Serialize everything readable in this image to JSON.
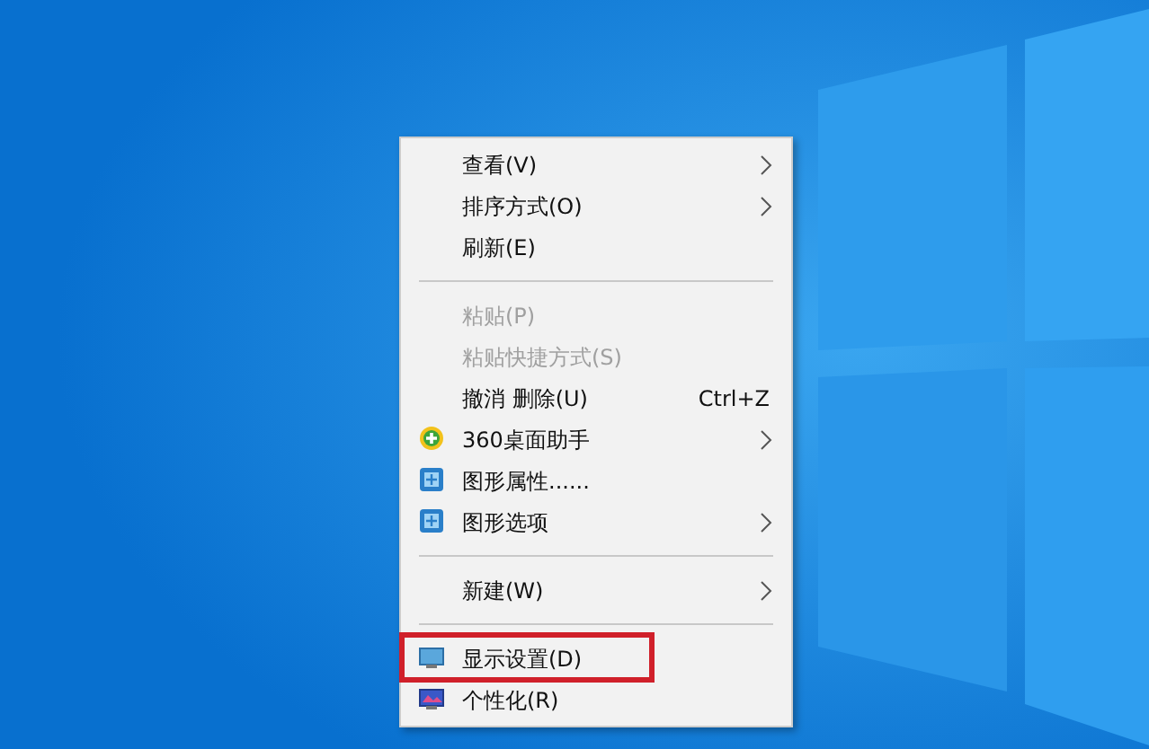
{
  "context_menu": {
    "items": [
      {
        "kind": "item",
        "label": "查看(V)",
        "submenu": true,
        "disabled": false
      },
      {
        "kind": "item",
        "label": "排序方式(O)",
        "submenu": true,
        "disabled": false
      },
      {
        "kind": "item",
        "label": "刷新(E)",
        "submenu": false,
        "disabled": false
      },
      {
        "kind": "separator"
      },
      {
        "kind": "item",
        "label": "粘贴(P)",
        "submenu": false,
        "disabled": true
      },
      {
        "kind": "item",
        "label": "粘贴快捷方式(S)",
        "submenu": false,
        "disabled": true
      },
      {
        "kind": "item",
        "label": "撤消 删除(U)",
        "shortcut": "Ctrl+Z",
        "submenu": false,
        "disabled": false
      },
      {
        "kind": "item",
        "label": "360桌面助手",
        "submenu": true,
        "disabled": false
      },
      {
        "kind": "item",
        "label": "图形属性......",
        "submenu": false,
        "disabled": false
      },
      {
        "kind": "item",
        "label": "图形选项",
        "submenu": true,
        "disabled": false
      },
      {
        "kind": "separator"
      },
      {
        "kind": "item",
        "label": "新建(W)",
        "submenu": true,
        "disabled": false
      },
      {
        "kind": "separator"
      },
      {
        "kind": "item",
        "label": "显示设置(D)",
        "submenu": false,
        "disabled": false,
        "highlighted": true
      },
      {
        "kind": "item",
        "label": "个性化(R)",
        "submenu": false,
        "disabled": false
      }
    ]
  }
}
